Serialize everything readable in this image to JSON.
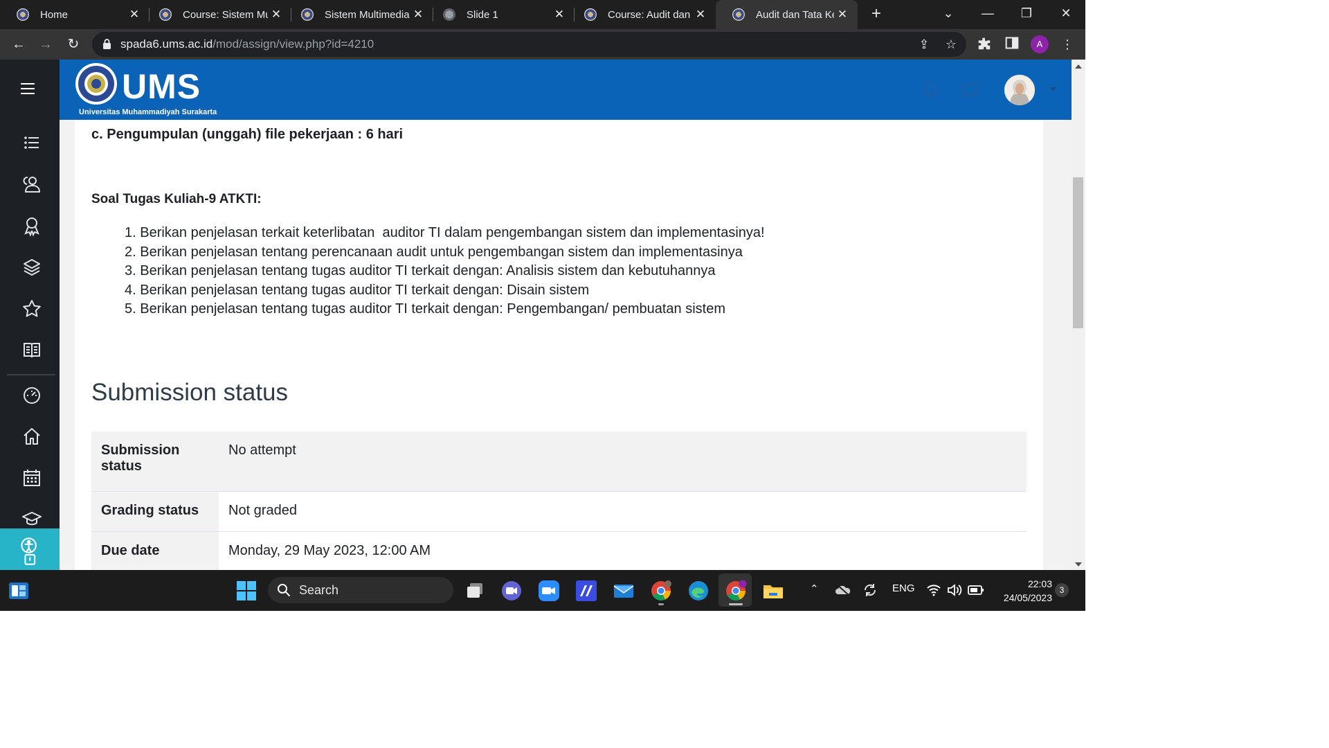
{
  "browser": {
    "tabs": [
      {
        "title": "Home",
        "icon": "ums-favicon"
      },
      {
        "title": "Course: Sistem Mul",
        "icon": "ums-favicon"
      },
      {
        "title": "Sistem Multimedia:",
        "icon": "ums-favicon"
      },
      {
        "title": "Slide 1",
        "icon": "globe-icon"
      },
      {
        "title": "Course: Audit dan T",
        "icon": "ums-favicon"
      },
      {
        "title": "Audit dan Tata Kelo",
        "icon": "ums-favicon",
        "active": true
      }
    ],
    "url_host": "spada6.ums.ac.id",
    "url_path": "/mod/assign/view.php?id=4210",
    "profile_initial": "A"
  },
  "site": {
    "logo_text": "UMS",
    "logo_subtitle": "Universitas Muhammadiyah Surakarta",
    "brand_color": "#0b63b8"
  },
  "content": {
    "line_c": "c. Pengumpulan (unggah) file pekerjaan : 6 hari",
    "soal_title": "Soal Tugas Kuliah-9 ATKTI:",
    "tasks": [
      "1. Berikan penjelasan terkait keterlibatan  auditor TI dalam pengembangan sistem dan implementasinya!",
      "2. Berikan penjelasan tentang perencanaan audit untuk pengembangan sistem dan implementasinya",
      "3. Berikan penjelasan tentang tugas auditor TI terkait dengan: Analisis sistem dan kebutuhannya",
      "4. Berikan penjelasan tentang tugas auditor TI terkait dengan: Disain sistem",
      "5. Berikan penjelasan tentang tugas auditor TI terkait dengan: Pengembangan/ pembuatan sistem"
    ],
    "submission_heading": "Submission status",
    "status_rows": [
      {
        "label": "Submission status",
        "value": "No attempt"
      },
      {
        "label": "Grading status",
        "value": "Not graded"
      },
      {
        "label": "Due date",
        "value": "Monday, 29 May 2023, 12:00 AM"
      }
    ]
  },
  "taskbar": {
    "search_label": "Search",
    "language": "ENG",
    "time": "22:03",
    "date": "24/05/2023",
    "notification_count": "3"
  }
}
